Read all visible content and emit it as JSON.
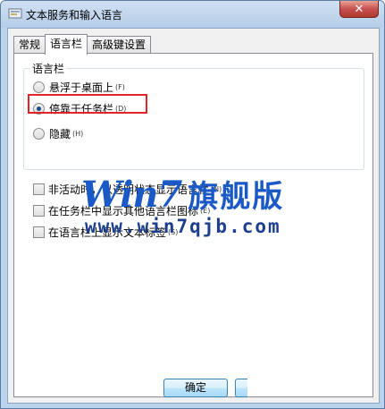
{
  "window": {
    "title": "文本服务和输入语言",
    "close_symbol": "✕"
  },
  "tabs": [
    {
      "label": "常规",
      "active": false
    },
    {
      "label": "语言栏",
      "active": true
    },
    {
      "label": "高级键设置",
      "active": false
    }
  ],
  "language_bar_group": {
    "label": "语言栏",
    "options": [
      {
        "label": "悬浮于桌面上",
        "accel": "(F)",
        "checked": false
      },
      {
        "label": "停靠于任务栏",
        "accel": "(D)",
        "checked": true
      },
      {
        "label": "隐藏",
        "accel": "(H)",
        "checked": false
      }
    ]
  },
  "checkboxes": [
    {
      "label": "非活动时，以透明状态显示语言栏",
      "accel": "(N)"
    },
    {
      "label": "在任务栏中显示其他语言栏图标",
      "accel": "(E)"
    },
    {
      "label": "在语言栏上显示文本标签",
      "accel": "(S)"
    }
  ],
  "footer": {
    "ok_label": "确定"
  },
  "watermark": {
    "brand_win": "Win",
    "brand_7": "7",
    "brand_cn": "旗舰版",
    "url": "www.win7qjb.com"
  },
  "colors": {
    "highlight": "#e0242a",
    "watermark": "#1a59c6"
  }
}
